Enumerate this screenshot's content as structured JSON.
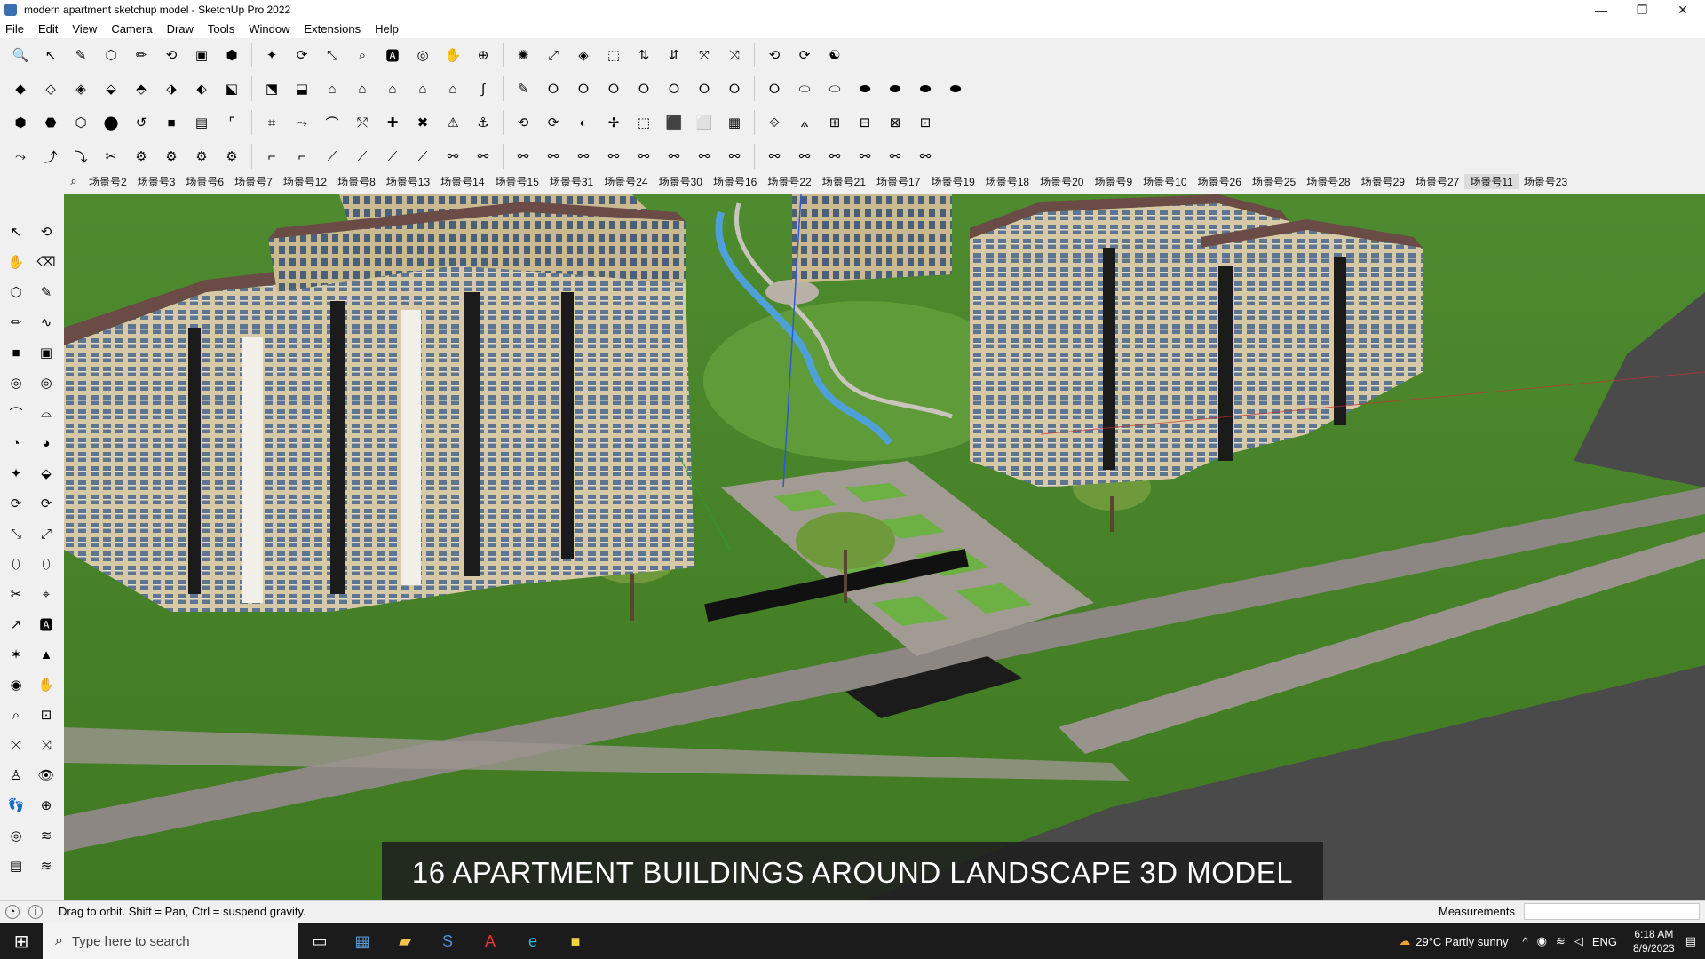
{
  "window": {
    "title": "modern apartment sketchup model - SketchUp Pro 2022",
    "minimize_glyph": "—",
    "maximize_glyph": "❐",
    "close_glyph": "✕"
  },
  "menu": [
    "File",
    "Edit",
    "View",
    "Camera",
    "Draw",
    "Tools",
    "Window",
    "Extensions",
    "Help"
  ],
  "toolbars": {
    "row1": [
      "🔍",
      "↖",
      "✎",
      "⬡",
      "✏",
      "⟲",
      "▣",
      "⬢",
      "✦",
      "⟳",
      "⤡",
      "⌕",
      "🅰",
      "◎",
      "✋",
      "⊕",
      "✺",
      "⤢",
      "◈",
      "⬚",
      "⇅",
      "⇵",
      "⤧",
      "⤨",
      "⟲",
      "⟳",
      "☯"
    ],
    "row2": [
      "◆",
      "◇",
      "◈",
      "⬙",
      "⬘",
      "⬗",
      "⬖",
      "⬕",
      "⬔",
      "⬓",
      "⌂",
      "⌂",
      "⌂",
      "⌂",
      "⌂",
      "∫",
      "✎",
      "⭘",
      "⭘",
      "⭘",
      "⭘",
      "⭘",
      "⭘",
      "⭘",
      "⭘",
      "⬭",
      "⬭",
      "⬬",
      "⬬",
      "⬬",
      "⬬"
    ],
    "row3": [
      "⬢",
      "⬣",
      "⬡",
      "⬤",
      "↺",
      "■",
      "▤",
      "⌜",
      "⌗",
      "⤳",
      "⌒",
      "⤲",
      "✚",
      "✖",
      "⚠",
      "⚓",
      "⟲",
      "⟳",
      "◐",
      "✢",
      "⬚",
      "⬛",
      "⬜",
      "▦",
      "⟐",
      "⟑",
      "⊞",
      "⊟",
      "⊠",
      "⊡"
    ],
    "row4": [
      "⤳",
      "⤴",
      "⤵",
      "✂",
      "⚙",
      "⚙",
      "⚙",
      "⚙",
      "⌐",
      "⌐",
      "⟋",
      "⟋",
      "⟋",
      "⟋",
      "⚯",
      "⚯",
      "⚯",
      "⚯",
      "⚯",
      "⚯",
      "⚯",
      "⚯",
      "⚯",
      "⚯",
      "⚯",
      "⚯",
      "⚯",
      "⚯",
      "⚯",
      "⚯"
    ]
  },
  "scenes": {
    "search_glyph": "⌕",
    "tabs": [
      "场景号2",
      "场景号3",
      "场景号6",
      "场景号7",
      "场景号12",
      "场景号8",
      "场景号13",
      "场景号14",
      "场景号15",
      "场景号31",
      "场景号24",
      "场景号30",
      "场景号16",
      "场景号22",
      "场景号21",
      "场景号17",
      "场景号19",
      "场景号18",
      "场景号20",
      "场景号9",
      "场景号10",
      "场景号26",
      "场景号25",
      "场景号28",
      "场景号29",
      "场景号27",
      "场景号11",
      "场景号23"
    ],
    "active": "场景号11"
  },
  "left_tools": [
    "↖",
    "⟲",
    "✋",
    "⌫",
    "⬡",
    "✎",
    "✏",
    "∿",
    "■",
    "▣",
    "◎",
    "◎",
    "⌒",
    "⌓",
    "◔",
    "◕",
    "✦",
    "⬙",
    "⟳",
    "⟳",
    "⤡",
    "⤢",
    "⬯",
    "⬯",
    "✂",
    "⌖",
    "↗",
    "🅰",
    "✶",
    "▲",
    "◉",
    "✋",
    "⌕",
    "⊡",
    "⤧",
    "⤨",
    "♙",
    "👁",
    "👣",
    "⊕",
    "◎",
    "≋",
    "▤",
    "≋"
  ],
  "caption": "16 APARTMENT BUILDINGS AROUND LANDSCAPE 3D MODEL",
  "status": {
    "message": "Drag to orbit. Shift = Pan, Ctrl = suspend gravity.",
    "measurements_label": "Measurements"
  },
  "taskbar": {
    "search_placeholder": "Type here to search",
    "weather": "29°C  Partly sunny",
    "language": "ENG",
    "time": "6:18 AM",
    "date": "8/9/2023"
  }
}
